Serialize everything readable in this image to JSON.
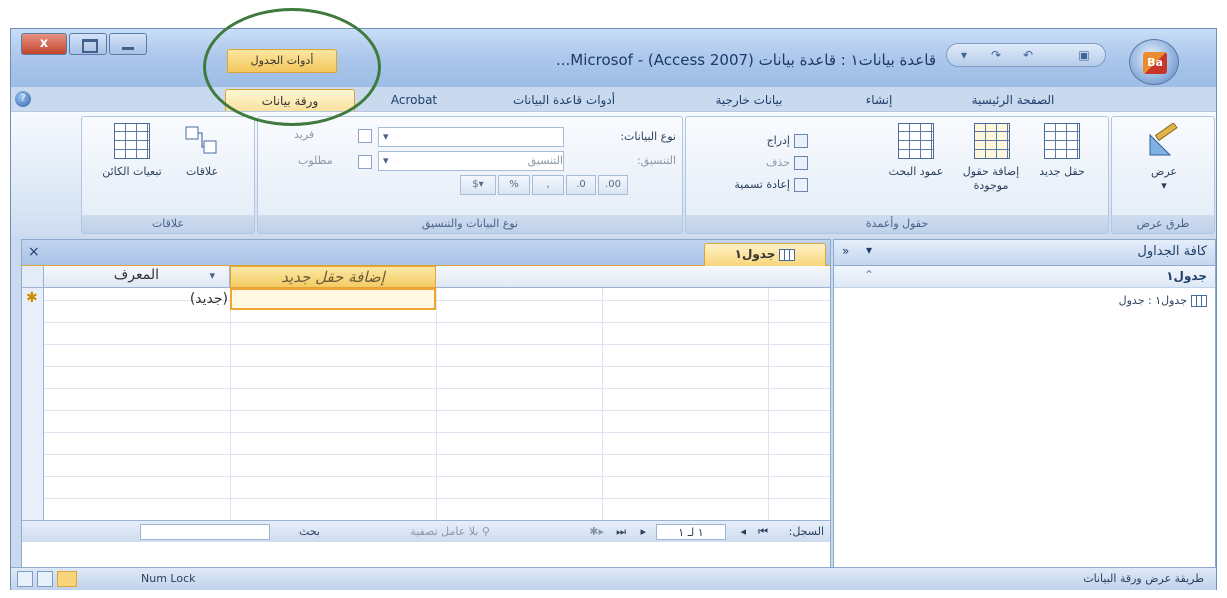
{
  "window": {
    "title": "قاعدة بيانات١ : قاعدة بيانات (Access 2007) - Microsof...",
    "context_header": "أدوات الجدول",
    "close_glyph": "x"
  },
  "office_logo": "Ba",
  "tabs": [
    {
      "label": "الصفحة الرئيسية"
    },
    {
      "label": "إنشاء"
    },
    {
      "label": "بيانات خارجية"
    },
    {
      "label": "أدوات قاعدة البيانات"
    },
    {
      "label": "Acrobat"
    },
    {
      "label": "ورقة بيانات"
    }
  ],
  "ribbon": {
    "views_group": {
      "label": "طرق عرض",
      "button": "عرض"
    },
    "fields_group": {
      "label": "حقول وأعمدة",
      "new_field": "حقل جديد",
      "add_existing": "إضافة حقول موجودة",
      "lookup_column": "عمود البحث",
      "insert": "إدراج",
      "delete": "حذف",
      "rename": "إعادة تسمية"
    },
    "datatype_group": {
      "label": "نوع البيانات والتنسيق",
      "datatype_label": "نوع البيانات:",
      "format_label": "التنسيق:",
      "format_placeholder": "التنسيق",
      "required": "مطلوب",
      "unique": "فريد",
      "currency_btn": "%",
      "percent_btn": "%"
    },
    "relations_group": {
      "label": "علاقات",
      "relationships": "علاقات",
      "dependencies": "تبعيات الكائن"
    }
  },
  "nav_pane": {
    "title": "كافة الجداول",
    "group": "جدول١",
    "item": "جدول١ : جدول"
  },
  "document": {
    "tab": "جدول١",
    "close": "×",
    "columns": {
      "id": "المعرف",
      "add": "إضافة حقل جديد"
    },
    "new_row": "(جديد)"
  },
  "record_nav": {
    "label": "السجل:",
    "position": "١ لـ ١",
    "filter": "بلا عامل تصفية",
    "search": "بحث"
  },
  "status": {
    "left": "طريقة عرض ورقة البيانات",
    "num_lock": "Num Lock"
  }
}
